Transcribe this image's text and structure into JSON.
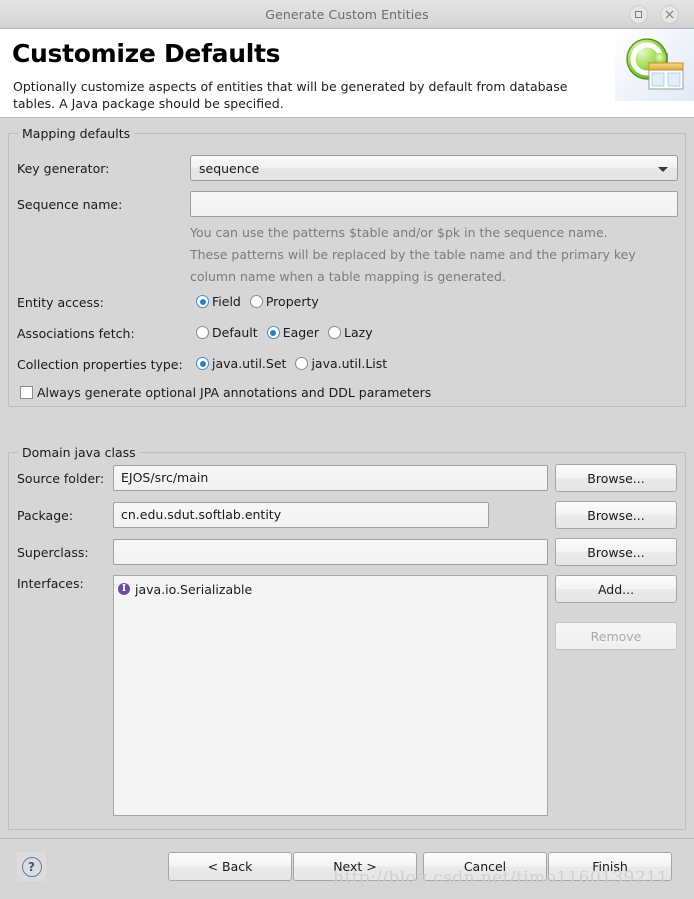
{
  "window": {
    "title": "Generate Custom Entities",
    "maximize_icon": "maximize-icon",
    "close_icon": "close-icon"
  },
  "banner": {
    "title": "Customize Defaults",
    "description": "Optionally customize aspects of entities that will be generated by default from database tables. A Java package should be specified.",
    "icon": "entities-wizard-icon"
  },
  "mapping": {
    "group_label": "Mapping defaults",
    "key_generator_label": "Key generator:",
    "key_generator_value": "sequence",
    "sequence_name_label": "Sequence name:",
    "sequence_name_value": "",
    "hint_line_1": "You can use the patterns $table and/or $pk in the sequence name.",
    "hint_line_2": "These patterns will be replaced by the table name and the primary key",
    "hint_line_3": "column name when a table mapping is generated.",
    "entity_access_label": "Entity access:",
    "entity_access_options": [
      {
        "label": "Field",
        "selected": true
      },
      {
        "label": "Property",
        "selected": false
      }
    ],
    "associations_fetch_label": "Associations fetch:",
    "associations_fetch_options": [
      {
        "label": "Default",
        "selected": false
      },
      {
        "label": "Eager",
        "selected": true
      },
      {
        "label": "Lazy",
        "selected": false
      }
    ],
    "collection_type_label": "Collection properties type:",
    "collection_type_options": [
      {
        "label": "java.util.Set",
        "selected": true
      },
      {
        "label": "java.util.List",
        "selected": false
      }
    ],
    "always_generate_label": "Always generate optional JPA annotations and DDL parameters",
    "always_generate_checked": false
  },
  "domain": {
    "group_label": "Domain java class",
    "source_folder_label": "Source folder:",
    "source_folder_value": "EJOS/src/main",
    "source_folder_browse": "Browse...",
    "package_label": "Package:",
    "package_value": "cn.edu.sdut.softlab.entity",
    "package_browse": "Browse...",
    "superclass_label": "Superclass:",
    "superclass_value": "",
    "superclass_browse": "Browse...",
    "interfaces_label": "Interfaces:",
    "interfaces_items": [
      "java.io.Serializable"
    ],
    "add_button": "Add...",
    "remove_button": "Remove",
    "remove_enabled": false
  },
  "footer": {
    "help_icon": "help-icon",
    "back_button": "< Back",
    "next_button": "Next >",
    "cancel_button": "Cancel",
    "finish_button": "Finish"
  },
  "watermark": "http://blog.csdn.net/timo1160139211",
  "colors": {
    "window_bg": "#d6d6d6",
    "banner_bg": "#ffffff",
    "radio_accent": "#2f7fbf",
    "interface_icon": "#6b4f9e"
  }
}
